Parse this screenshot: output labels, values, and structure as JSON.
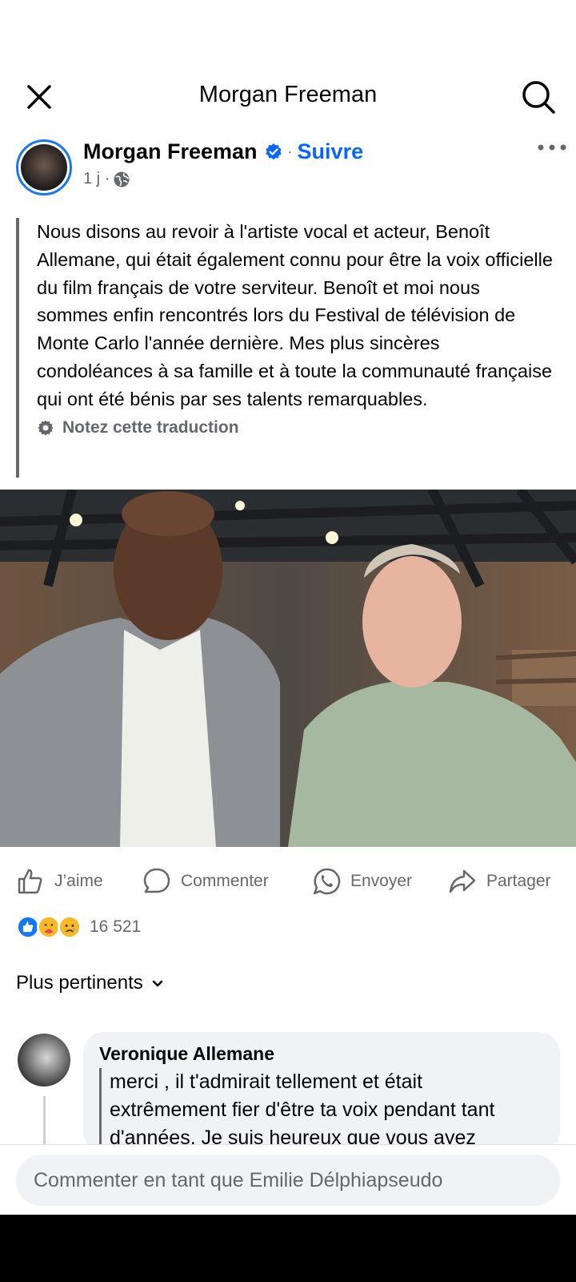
{
  "header": {
    "title": "Morgan Freeman"
  },
  "post": {
    "author": "Morgan Freeman",
    "follow_label": "Suivre",
    "separator": "·",
    "time": "1 j ·",
    "text": "Nous disons au revoir à l'artiste vocal et acteur, Benoît Allemane, qui était également connu pour être la voix officielle du film français de votre serviteur. Benoît et moi nous sommes enfin rencontrés lors du Festival de télévision de Monte Carlo l'année dernière. Mes plus sincères condoléances à sa famille et à toute la communauté française qui ont été bénis par ses talents remarquables.",
    "rate_translation": "Notez cette traduction"
  },
  "actions": {
    "like": "J’aime",
    "comment": "Commenter",
    "send": "Envoyer",
    "share": "Partager"
  },
  "reactions": {
    "count": "16 521",
    "types": [
      "like-icon",
      "care-icon",
      "sad-icon"
    ]
  },
  "comments": {
    "sort_label": "Plus pertinents",
    "items": [
      {
        "author": "Veronique Allemane",
        "text": "merci , il t'admirait tellement et était extrêmement fier d'être ta voix pendant tant d'années. Je suis heureux que vous ayez"
      }
    ]
  },
  "composer": {
    "placeholder": "Commenter en tant que Emilie Délphiapseudo"
  },
  "colors": {
    "accent": "#0866ff",
    "secondary_text": "#65676b",
    "bubble_bg": "#f0f2f5"
  }
}
